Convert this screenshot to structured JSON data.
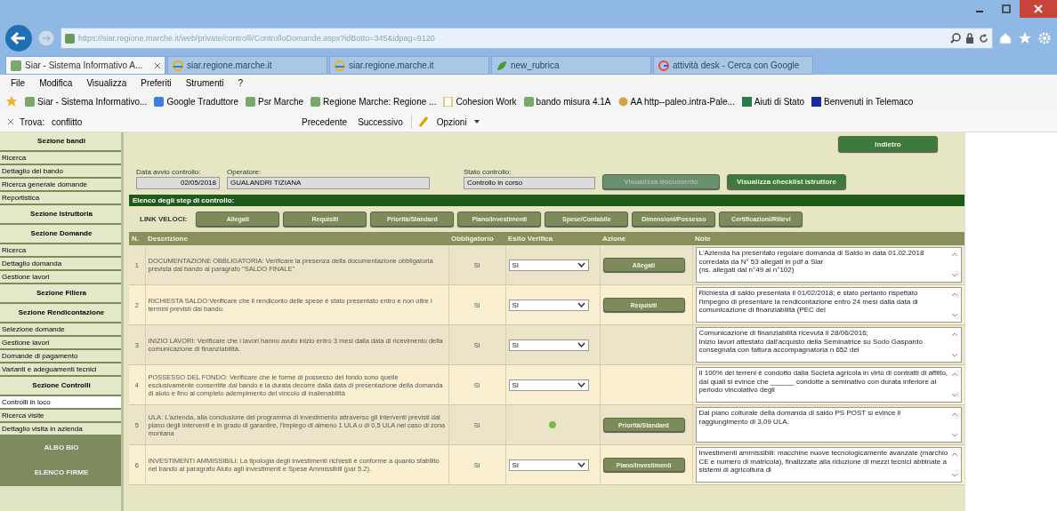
{
  "address_bar": {
    "url": "https://siar.regione.marche.it/web/private/controlli/ControlloDomande.aspx?idBotto=345&idpag=9120"
  },
  "tabs": [
    {
      "label": "Siar - Sistema Informativo A...",
      "selected": true
    },
    {
      "label": "siar.regione.marche.it",
      "selected": false
    },
    {
      "label": "siar.regione.marche.it",
      "selected": false
    },
    {
      "label": "new_rubrica",
      "selected": false
    },
    {
      "label": "attività desk - Cerca con Google",
      "selected": false
    }
  ],
  "menu": [
    "File",
    "Modifica",
    "Visualizza",
    "Preferiti",
    "Strumenti",
    "?"
  ],
  "favorites": [
    "Siar - Sistema Informativo...",
    "Google Traduttore",
    "Psr Marche",
    "Regione Marche: Regione ...",
    "Cohesion Work",
    "bando misura 4.1A",
    "AA http--paleo.intra-Pale...",
    "Aiuti di Stato",
    "Benvenuti in Telemaco"
  ],
  "find_bar": {
    "label": "Trova:",
    "value": "conflitto",
    "buttons": [
      "Precedente",
      "Successivo"
    ],
    "options": "Opzioni"
  },
  "sidebar": {
    "items": [
      {
        "label": "Sezione bandi",
        "kind": "header",
        "selected": false
      },
      {
        "label": "Ricerca",
        "kind": "link",
        "selected": false
      },
      {
        "label": "Dettaglio del bando",
        "kind": "link",
        "selected": false
      },
      {
        "label": "Ricerca generale domande",
        "kind": "link",
        "selected": false
      },
      {
        "label": "Reportistica",
        "kind": "link",
        "selected": false
      },
      {
        "label": "Sezione Istruttoria",
        "kind": "header",
        "selected": false
      },
      {
        "label": "Sezione Domande",
        "kind": "header",
        "selected": false
      },
      {
        "label": "Ricerca",
        "kind": "link",
        "selected": false
      },
      {
        "label": "Dettaglio domanda",
        "kind": "link",
        "selected": false
      },
      {
        "label": "Gestione lavori",
        "kind": "link",
        "selected": false
      },
      {
        "label": "Sezione Filiera",
        "kind": "header",
        "selected": false
      },
      {
        "label": "Sezione Rendicontazione",
        "kind": "header",
        "selected": false
      },
      {
        "label": "Selezione domande",
        "kind": "link",
        "selected": false
      },
      {
        "label": "Gestione lavori",
        "kind": "link",
        "selected": false
      },
      {
        "label": "Domande di pagamento",
        "kind": "link",
        "selected": false
      },
      {
        "label": "Varianti e adeguamenti tecnici",
        "kind": "link",
        "selected": false
      },
      {
        "label": "Sezione Controlli",
        "kind": "header",
        "selected": false
      },
      {
        "label": "Controlli in loco",
        "kind": "link",
        "selected": true
      },
      {
        "label": "Ricerca visite",
        "kind": "link",
        "selected": false
      },
      {
        "label": "Dettaglio visita in azienda",
        "kind": "link",
        "selected": false
      },
      {
        "label": "ALBO BIO",
        "kind": "dark",
        "selected": false
      },
      {
        "label": "ELENCO FIRME",
        "kind": "dark",
        "selected": false
      }
    ]
  },
  "back_button": "Indietro",
  "fields": [
    {
      "label": "Data avvio controllo:",
      "value": "02/05/2018",
      "kind": "date"
    },
    {
      "label": "Operatore:",
      "value": "GUALANDRI TIZIANA",
      "kind": "wide"
    },
    {
      "label": "Stato controllo:",
      "value": "Controllo in corso",
      "kind": "medium"
    }
  ],
  "actions": [
    {
      "label": "Visualizza documento",
      "disabled": true
    },
    {
      "label": "Visualizza checklist istruttore",
      "disabled": false
    }
  ],
  "section_title": "Elenco degli step di controllo:",
  "quick_links": {
    "label": "LINK VELOCI:",
    "items": [
      "Allegati",
      "Requisiti",
      "Priorità/Standard",
      "Piano/Investimenti",
      "Spese/Contabile",
      "Dimensioni/Possesso",
      "Certificazioni/Rilievi"
    ]
  },
  "table": {
    "columns": [
      "N.",
      "Descrizione",
      "Obbligatorio",
      "Esito Verifica",
      "Azione",
      "Note"
    ],
    "rows": [
      {
        "n": "1",
        "description": "DOCUMENTAZIONE OBBLIGATORIA: Verificare la presenza della documentazione obbligatoria prevista dal bando al paragrafo \"SALDO FINALE\"",
        "mandatory": "Si",
        "result": {
          "kind": "select",
          "value": "SI"
        },
        "action": "Allegati",
        "note": "L'Azienda ha presentato regolare domanda di Saldo in data 01.02.2018 corredata da N° 53 allegati in pdf a Siar\n(ns. allegati dal n°49 al n°102)"
      },
      {
        "n": "2",
        "description": "RICHIESTA SALDO:Verificare che il rendiconto delle spese è stato presentato entro e non oltre i termini previsti dal bando.",
        "mandatory": "Si",
        "result": {
          "kind": "select",
          "value": "SI"
        },
        "action": "Requisiti",
        "note": "Richiesta di saldo presentata il 01/02/2018; è stato pertanto rispettato l'impegno di presentare la rendicontazione entro 24 mesi dalla data di comunicazione di finanziabilità (PEC del"
      },
      {
        "n": "3",
        "description": "INIZIO LAVORI: Verificare che i lavori hanno avuto inizio entro 3 mesi dalla data di ricevimento della comunicazione di finanziabilità.",
        "mandatory": "Si",
        "result": {
          "kind": "select",
          "value": "SI"
        },
        "note": "Comunicazione di finanziabilità ricevuta il 28/06/2016;\nInizio lavori attestato dall'acquisto della Seminatrice su Sodo Gaspardo consegnata con fattura accompagnatoria n 652 del"
      },
      {
        "n": "4",
        "description": "POSSESSO DEL FONDO: Verificare che le forme di possesso del fondo sono quelle esclusivamente consentite dal bando e la durata decorre dalla data di presentazione della domanda di aiuto e fino al completo adempimento del vincolo di inalienabilità",
        "mandatory": "Si",
        "result": {
          "kind": "select",
          "value": "SI"
        },
        "note": "Il 100% dei terreni è condotto dalla Società agricola in virtù di contratti di affitto, dai quali si evince che ______ condotte a seminativo con durata inferiore al periodo vincolativo degli"
      },
      {
        "n": "5",
        "description": "ULA: L'azienda, alla conclusione del programma di investimento attraverso gli interventi previsti dal piano degli interventi è in grado di garantire, l'impiego di almeno 1 ULA o di 0,5 ULA nel caso di zona montana",
        "mandatory": "Si",
        "result": {
          "kind": "icon"
        },
        "action": "Priorità/Standard",
        "note": "Dal piano colturale della domanda di saldo PS POST si evince il raggiungimento di 3,09 ULA."
      },
      {
        "n": "6",
        "description": "INVESTIMENTI AMMISSIBILI: La tipologia degli investimenti richiesti è conforme a quanto stabilito nel bando al paragrafo Aiuto agli investimenti e Spese Ammissibili (par 5.2).",
        "mandatory": "Si",
        "result": {
          "kind": "select",
          "value": "SI"
        },
        "action": "Piano/Investimenti",
        "note": "Investimenti ammissibili: macchine nuove tecnologicamente avanzate (marchio CE e numero di matricola), finalizzate alla riduzione di mezzi tecnici abbinate a sistemi di agricoltura di"
      }
    ]
  }
}
